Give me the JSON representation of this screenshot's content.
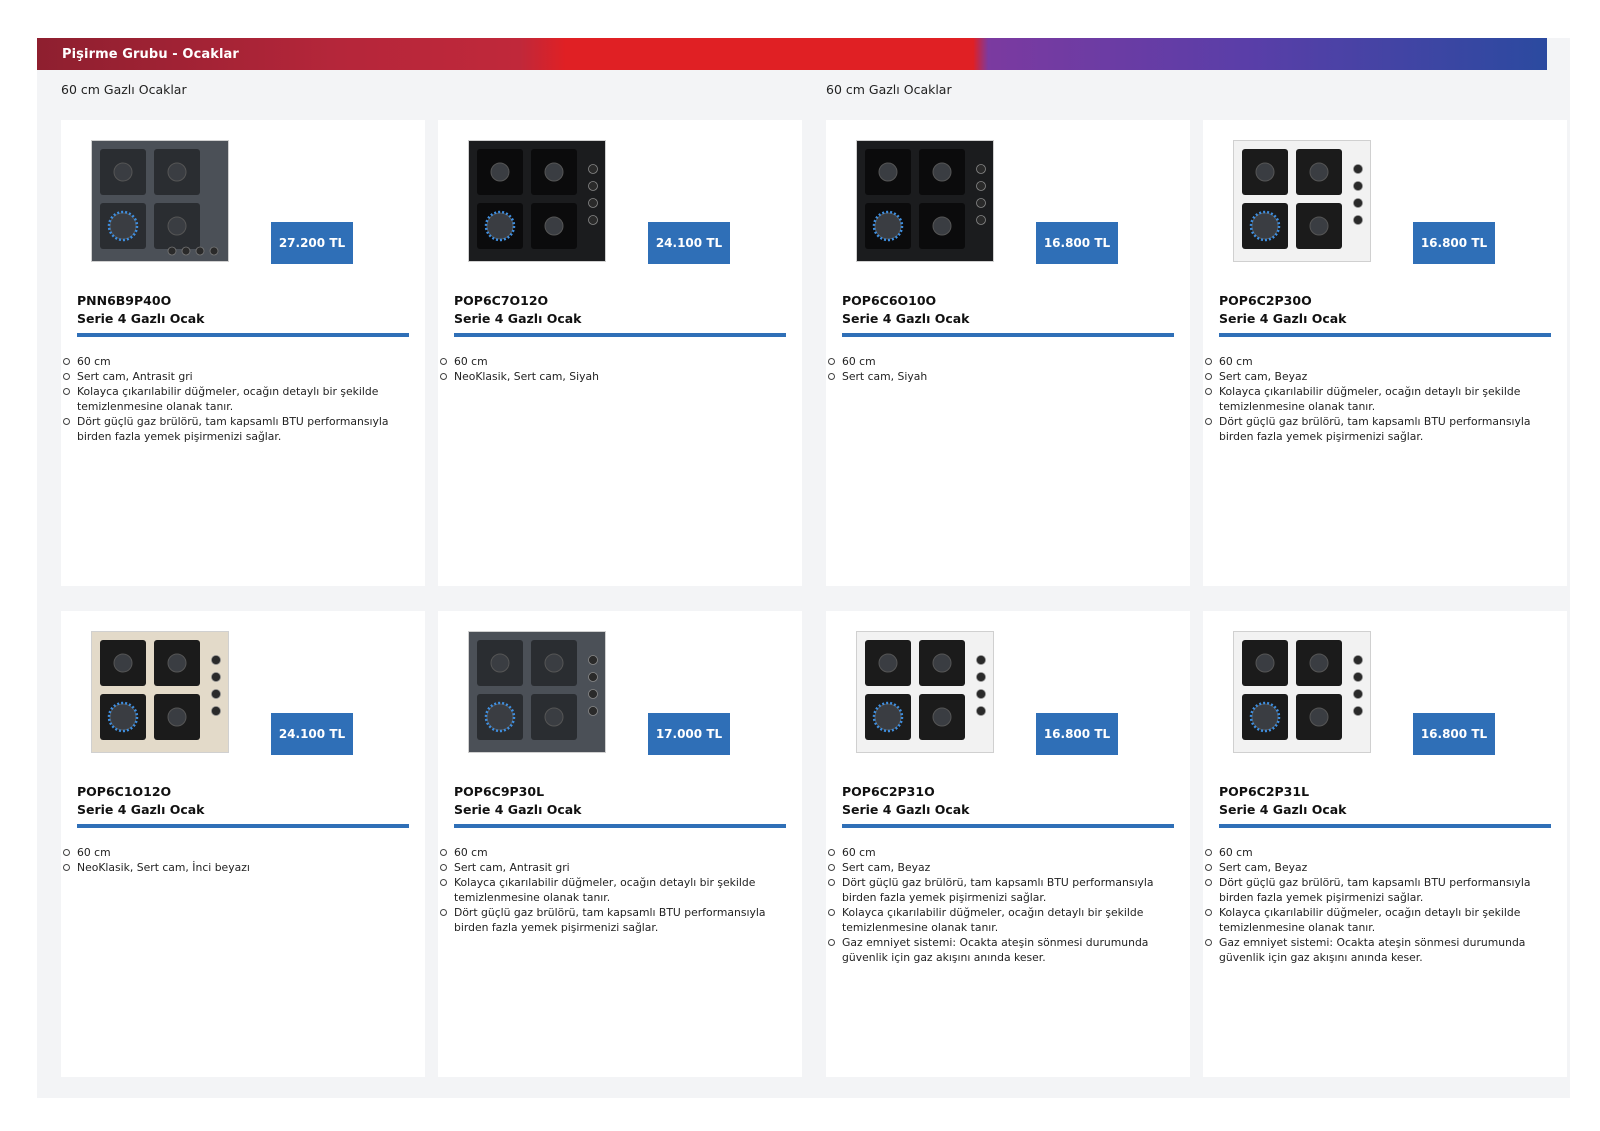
{
  "header": {
    "title": "Pişirme Grubu - Ocaklar"
  },
  "sections": [
    {
      "label": "60 cm Gazlı Ocaklar"
    },
    {
      "label": "60 cm Gazlı Ocaklar"
    }
  ],
  "products": [
    {
      "model": "PNN6B9P40O",
      "series": "Serie 4 Gazlı Ocak",
      "price": "27.200 TL",
      "image_style": "antrasit-6knob",
      "features": [
        "60 cm",
        "Sert cam, Antrasit gri",
        "Kolayca çıkarılabilir düğmeler, ocağın detaylı bir şekilde temizlenmesine olanak tanır.",
        "Dört güçlü gaz brülörü, tam kapsamlı BTU performansıyla birden fazla yemek pişirmenizi sağlar."
      ]
    },
    {
      "model": "POP6C7O12O",
      "series": "Serie 4 Gazlı Ocak",
      "price": "24.100 TL",
      "image_style": "black-side",
      "features": [
        "60 cm",
        "NeoKlasik, Sert cam, Siyah"
      ]
    },
    {
      "model": "POP6C6O10O",
      "series": "Serie 4 Gazlı Ocak",
      "price": "16.800 TL",
      "image_style": "black-side",
      "features": [
        "60 cm",
        "Sert cam, Siyah"
      ]
    },
    {
      "model": "POP6C2P30O",
      "series": "Serie 4 Gazlı Ocak",
      "price": "16.800 TL",
      "image_style": "white-side",
      "features": [
        "60 cm",
        "Sert cam, Beyaz",
        "Kolayca çıkarılabilir düğmeler, ocağın detaylı bir şekilde temizlenmesine olanak tanır.",
        "Dört güçlü gaz brülörü, tam kapsamlı BTU performansıyla birden fazla yemek pişirmenizi sağlar."
      ]
    },
    {
      "model": "POP6C1O12O",
      "series": "Serie 4 Gazlı Ocak",
      "price": "24.100 TL",
      "image_style": "cream-side",
      "features": [
        "60 cm",
        "NeoKlasik, Sert cam, İnci beyazı"
      ]
    },
    {
      "model": "POP6C9P30L",
      "series": "Serie 4 Gazlı Ocak",
      "price": "17.000 TL",
      "image_style": "antrasit-side",
      "features": [
        "60 cm",
        "Sert cam, Antrasit gri",
        "Kolayca çıkarılabilir düğmeler, ocağın detaylı bir şekilde temizlenmesine olanak tanır.",
        "Dört güçlü gaz brülörü, tam kapsamlı BTU performansıyla birden fazla yemek pişirmenizi sağlar."
      ]
    },
    {
      "model": "POP6C2P31O",
      "series": "Serie 4 Gazlı Ocak",
      "price": "16.800 TL",
      "image_style": "white-side",
      "features": [
        "60 cm",
        "Sert cam, Beyaz",
        "Dört güçlü gaz brülörü, tam kapsamlı BTU performansıyla birden fazla yemek pişirmenizi sağlar.",
        "Kolayca çıkarılabilir düğmeler, ocağın detaylı bir şekilde temizlenmesine olanak tanır.",
        "Gaz emniyet sistemi: Ocakta ateşin sönmesi durumunda güvenlik için gaz akışını anında keser."
      ]
    },
    {
      "model": "POP6C2P31L",
      "series": "Serie 4 Gazlı Ocak",
      "price": "16.800 TL",
      "image_style": "white-side",
      "features": [
        "60 cm",
        "Sert cam, Beyaz",
        "Dört güçlü gaz brülörü, tam kapsamlı BTU performansıyla birden fazla yemek pişirmenizi sağlar.",
        "Kolayca çıkarılabilir düğmeler, ocağın detaylı bir şekilde temizlenmesine olanak tanır.",
        "Gaz emniyet sistemi: Ocakta ateşin sönmesi durumunda güvenlik için gaz akışını anında keser."
      ]
    }
  ],
  "colors": {
    "accent_blue": "#2f6fb7",
    "page_background": "#f3f4f6",
    "banner_red": "#e02024",
    "banner_purple": "#5a3ea8",
    "banner_blue": "#2b4aa0"
  }
}
